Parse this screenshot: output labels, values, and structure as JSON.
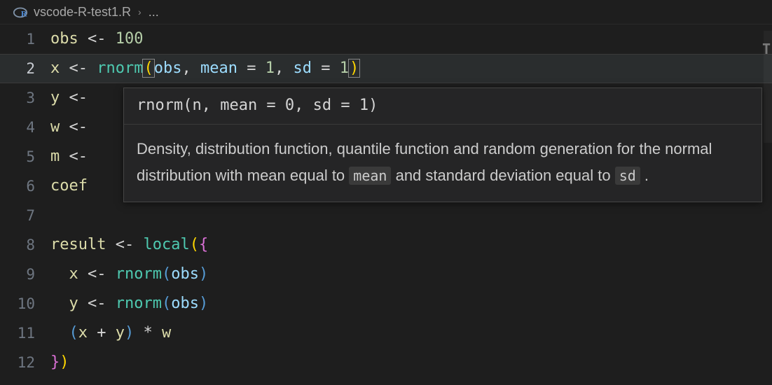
{
  "breadcrumb": {
    "filename": "vscode-R-test1.R",
    "chevron": "›",
    "rest": "..."
  },
  "lines": {
    "l1": {
      "num": "1",
      "v": "obs",
      "assign": "<-",
      "val": "100"
    },
    "l2": {
      "num": "2",
      "v": "x",
      "assign": "<-",
      "fn": "rnorm",
      "a1": "obs",
      "p1": "mean",
      "eq": "=",
      "n1": "1",
      "p2": "sd",
      "n2": "1"
    },
    "l3": {
      "num": "3",
      "v": "y",
      "assign": "<"
    },
    "l4": {
      "num": "4",
      "v": "w",
      "assign": "<"
    },
    "l5": {
      "num": "5",
      "v": "m",
      "assign": "<"
    },
    "l6": {
      "num": "6",
      "v": "coef"
    },
    "l7": {
      "num": "7"
    },
    "l8": {
      "num": "8",
      "v": "result",
      "assign": "<-",
      "fn": "local"
    },
    "l9": {
      "num": "9",
      "v": "x",
      "assign": "<-",
      "fn": "rnorm",
      "a1": "obs"
    },
    "l10": {
      "num": "10",
      "v": "y",
      "assign": "<-",
      "fn": "rnorm",
      "a1": "obs"
    },
    "l11": {
      "num": "11",
      "a": "x",
      "b": "y",
      "c": "w"
    },
    "l12": {
      "num": "12"
    }
  },
  "hover": {
    "sig": "rnorm(n, mean = 0, sd = 1)",
    "doc_pre1": "Density, distribution function, quantile function and random generation for the normal distribution with mean equal to ",
    "doc_code1": "mean",
    "doc_mid": " and standard deviation equal to ",
    "doc_code2": "sd",
    "doc_end": " ."
  },
  "punc": {
    "openp": "(",
    "closep": ")",
    "comma": ",",
    "openb": "{",
    "closeb": "}",
    "plus": "+",
    "star": "*",
    "dash": "-"
  },
  "minimap": {
    "mark": "T"
  }
}
